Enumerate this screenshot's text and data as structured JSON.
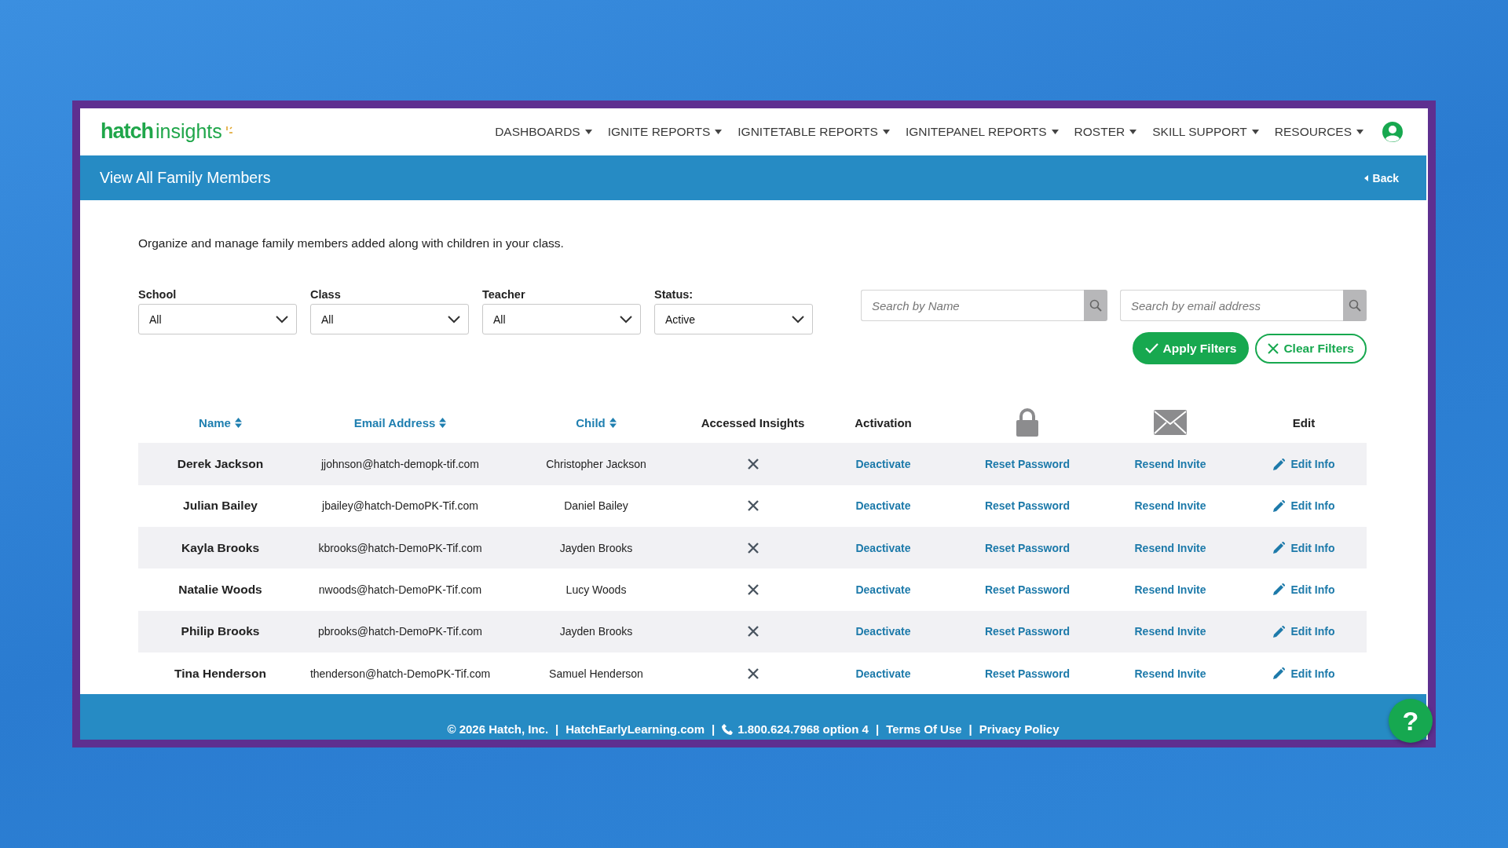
{
  "header": {
    "logo_main": "hatch",
    "logo_sub": "insights",
    "nav": [
      {
        "label": "DASHBOARDS"
      },
      {
        "label": "IGNITE REPORTS"
      },
      {
        "label": "IGNITETABLE REPORTS"
      },
      {
        "label": "IGNITEPANEL REPORTS"
      },
      {
        "label": "ROSTER"
      },
      {
        "label": "SKILL SUPPORT"
      },
      {
        "label": "RESOURCES"
      }
    ]
  },
  "title_bar": {
    "title": "View All Family Members",
    "back": "Back"
  },
  "description": "Organize and manage family members added along with children in your class.",
  "filters": [
    {
      "label": "School",
      "value": "All"
    },
    {
      "label": "Class",
      "value": "All"
    },
    {
      "label": "Teacher",
      "value": "All"
    },
    {
      "label": "Status:",
      "value": "Active"
    }
  ],
  "searches": [
    {
      "placeholder": "Search by Name"
    },
    {
      "placeholder": "Search by email address"
    }
  ],
  "actions": {
    "apply": "Apply Filters",
    "clear": "Clear Filters"
  },
  "table": {
    "columns": [
      {
        "kind": "sortable",
        "label": "Name"
      },
      {
        "kind": "sortable",
        "label": "Email Address"
      },
      {
        "kind": "sortable",
        "label": "Child"
      },
      {
        "kind": "text",
        "label": "Accessed Insights"
      },
      {
        "kind": "text",
        "label": "Activation"
      },
      {
        "kind": "icon"
      },
      {
        "kind": "icon"
      },
      {
        "kind": "text",
        "label": "Edit"
      }
    ],
    "rows": [
      {
        "name": "Derek Jackson",
        "email": "jjohnson@hatch-demopk-tif.com",
        "child": "Christopher Jackson",
        "accessed": false,
        "activation": "Deactivate",
        "reset": "Reset Password",
        "invite": "Resend Invite",
        "edit": "Edit Info"
      },
      {
        "name": "Julian Bailey",
        "email": "jbailey@hatch-DemoPK-Tif.com",
        "child": "Daniel Bailey",
        "accessed": false,
        "activation": "Deactivate",
        "reset": "Reset Password",
        "invite": "Resend Invite",
        "edit": "Edit Info"
      },
      {
        "name": "Kayla Brooks",
        "email": "kbrooks@hatch-DemoPK-Tif.com",
        "child": "Jayden Brooks",
        "accessed": false,
        "activation": "Deactivate",
        "reset": "Reset Password",
        "invite": "Resend Invite",
        "edit": "Edit Info"
      },
      {
        "name": "Natalie Woods",
        "email": "nwoods@hatch-DemoPK-Tif.com",
        "child": "Lucy Woods",
        "accessed": false,
        "activation": "Deactivate",
        "reset": "Reset Password",
        "invite": "Resend Invite",
        "edit": "Edit Info"
      },
      {
        "name": "Philip Brooks",
        "email": "pbrooks@hatch-DemoPK-Tif.com",
        "child": "Jayden Brooks",
        "accessed": false,
        "activation": "Deactivate",
        "reset": "Reset Password",
        "invite": "Resend Invite",
        "edit": "Edit Info"
      },
      {
        "name": "Tina Henderson",
        "email": "thenderson@hatch-DemoPK-Tif.com",
        "child": "Samuel Henderson",
        "accessed": false,
        "activation": "Deactivate",
        "reset": "Reset Password",
        "invite": "Resend Invite",
        "edit": "Edit Info"
      }
    ]
  },
  "footer": [
    {
      "kind": "text",
      "text": "© 2026 Hatch, Inc."
    },
    {
      "kind": "separator",
      "text": "|"
    },
    {
      "kind": "link",
      "text": "HatchEarlyLearning.com"
    },
    {
      "kind": "separator",
      "text": "|"
    },
    {
      "kind": "phone",
      "text": "1.800.624.7968 option 4"
    },
    {
      "kind": "separator",
      "text": "|"
    },
    {
      "kind": "link",
      "text": "Terms Of Use"
    },
    {
      "kind": "separator",
      "text": "|"
    },
    {
      "kind": "link",
      "text": "Privacy Policy"
    }
  ],
  "help": "?"
}
